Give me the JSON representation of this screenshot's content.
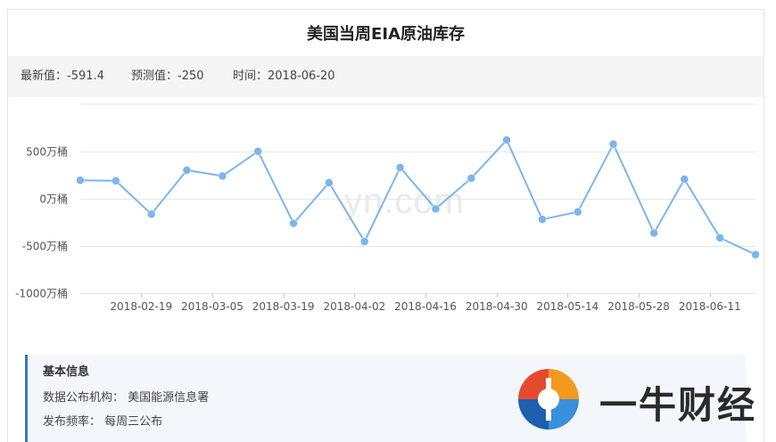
{
  "title": "美国当周EIA原油库存",
  "stats": {
    "latest_label": "最新值：",
    "latest_value": "-591.4",
    "forecast_label": "预测值：",
    "forecast_value": "-250",
    "time_label": "时间：",
    "time_value": "2018-06-20"
  },
  "watermark": "yn.com",
  "info": {
    "heading": "基本信息",
    "org_label": "数据公布机构：",
    "org_value": "美国能源信息署",
    "freq_label": "发布频率：",
    "freq_value": "每周三公布"
  },
  "logo": {
    "text": "一牛财经",
    "colors": [
      "#f39a1e",
      "#e64a2e",
      "#3a8fdc",
      "#1e5fb0"
    ]
  },
  "chart_data": {
    "type": "line",
    "ylim": [
      -1000,
      1000
    ],
    "y_unit": "万桶",
    "y_ticks": [
      {
        "value": 500,
        "label": "500万桶"
      },
      {
        "value": 0,
        "label": "0万桶"
      },
      {
        "value": -500,
        "label": "-500万桶"
      },
      {
        "value": -1000,
        "label": "-1000万桶"
      }
    ],
    "x_tick_labels": [
      "2018-02-19",
      "2018-03-05",
      "2018-03-19",
      "2018-04-02",
      "2018-04-16",
      "2018-04-30",
      "2018-05-14",
      "2018-05-28",
      "2018-06-11"
    ],
    "dates": [
      "2018-02-07",
      "2018-02-14",
      "2018-02-21",
      "2018-02-28",
      "2018-03-07",
      "2018-03-14",
      "2018-03-21",
      "2018-03-28",
      "2018-04-04",
      "2018-04-11",
      "2018-04-18",
      "2018-04-25",
      "2018-05-02",
      "2018-05-09",
      "2018-05-16",
      "2018-05-23",
      "2018-05-31",
      "2018-06-06",
      "2018-06-13",
      "2018-06-20"
    ],
    "series": [
      {
        "color": "#7cb5ec",
        "values": [
          195,
          190,
          -163,
          302,
          241,
          502,
          -260,
          170,
          -454,
          330,
          -107,
          217,
          622,
          -219,
          -140,
          578,
          -362,
          207,
          -414,
          -591.4
        ]
      }
    ],
    "grid": true,
    "legend": "none"
  }
}
